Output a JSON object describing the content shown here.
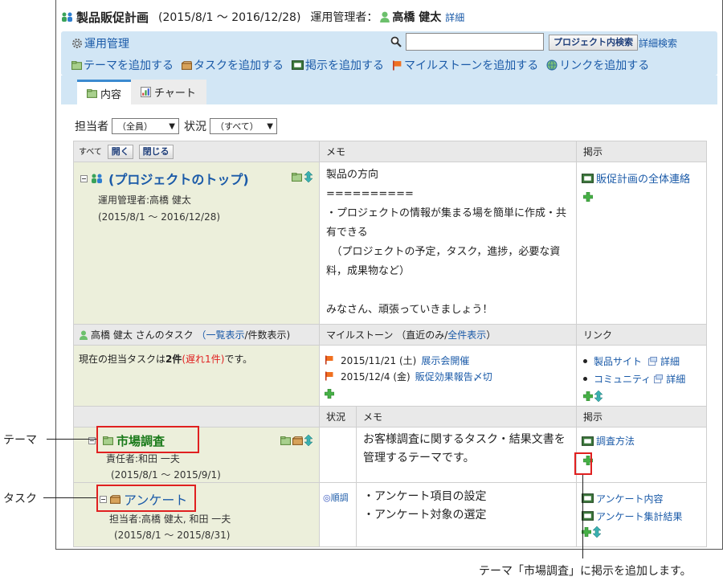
{
  "header": {
    "title": "製品販促計画",
    "period": "(2015/8/1 ～ 2016/12/28)",
    "manager_label": "運用管理者：",
    "manager_name": "高橋 健太",
    "detail_link": "詳細"
  },
  "toolbar": {
    "admin_label": "運用管理",
    "search_placeholder": "",
    "search_button": "プロジェクト内検索",
    "advanced_search": "詳細検索",
    "add_theme": "テーマを追加する",
    "add_task": "タスクを追加する",
    "add_bulletin": "掲示を追加する",
    "add_milestone": "マイルストーンを追加する",
    "add_link": "リンクを追加する"
  },
  "tabs": [
    {
      "label": "内容",
      "active": true
    },
    {
      "label": "チャート",
      "active": false
    }
  ],
  "filters": {
    "assignee_label": "担当者",
    "assignee_value": "（全員）",
    "status_label": "状況",
    "status_value": "（すべて）"
  },
  "grid": {
    "all_label": "すべて",
    "open_button": "開く",
    "close_button": "閉じる",
    "memo_header": "メモ",
    "bulletin_header": "掲示",
    "project_title": "(プロジェクトのトップ)",
    "project_manager": "運用管理者:高橋 健太",
    "project_period": "(2015/8/1 ～ 2016/12/28)",
    "project_memo": "製品の方向\n==========\n・プロジェクトの情報が集まる場を簡単に作成・共有できる\n　（プロジェクトの予定，タスク，進捗，必要な資料，成果物など）\n\nみなさん、頑張っていきましょう！",
    "project_bulletin": "販促計画の全体連絡",
    "tasks_user": "高橋 健太 さんのタスク",
    "tasks_list_view": "（一覧表示",
    "tasks_count_view": "/件数表示)",
    "milestone_header_a": "マイルストーン （直近のみ/",
    "milestone_header_b": "全件表示",
    "milestone_header_c": "）",
    "link_header": "リンク",
    "task_summary_a": "現在の担当タスクは",
    "task_summary_count": "2件",
    "task_summary_late": "(遅れ1件)",
    "task_summary_b": "です。",
    "milestones": [
      {
        "date": "2015/11/21 (土)",
        "label": "展示会開催"
      },
      {
        "date": "2015/12/4 (金)",
        "label": "販促効果報告〆切"
      }
    ],
    "links": [
      {
        "label": "製品サイト",
        "detail": "詳細"
      },
      {
        "label": "コミュニティ",
        "detail": "詳細"
      }
    ],
    "status_header": "状況",
    "theme_title": "市場調査",
    "theme_owner": "責任者:和田 一夫",
    "theme_period": "(2015/8/1 ～ 2015/9/1)",
    "theme_memo": "お客様調査に関するタスク・結果文書を管理するテーマです。",
    "theme_bulletin": "調査方法",
    "task_title": "アンケート",
    "task_assignees": "担当者:高橋 健太, 和田 一夫",
    "task_period": "(2015/8/1 ～ 2015/8/31)",
    "task_status": "順調",
    "task_memo_lines": [
      "・アンケート項目の設定",
      "・アンケート対象の選定"
    ],
    "task_bulletins": [
      "アンケート内容",
      "アンケート集計結果"
    ]
  },
  "annotations": {
    "theme": "テーマ",
    "task": "タスク",
    "add_bulletin_note": "テーマ「市場調査」に掲示を追加します。"
  },
  "colors": {
    "accent_blue": "#1a5aa8",
    "toolbar_bg": "#d2e6f5",
    "tan_row": "#ecefdb",
    "annotation_red": "#e02020"
  }
}
